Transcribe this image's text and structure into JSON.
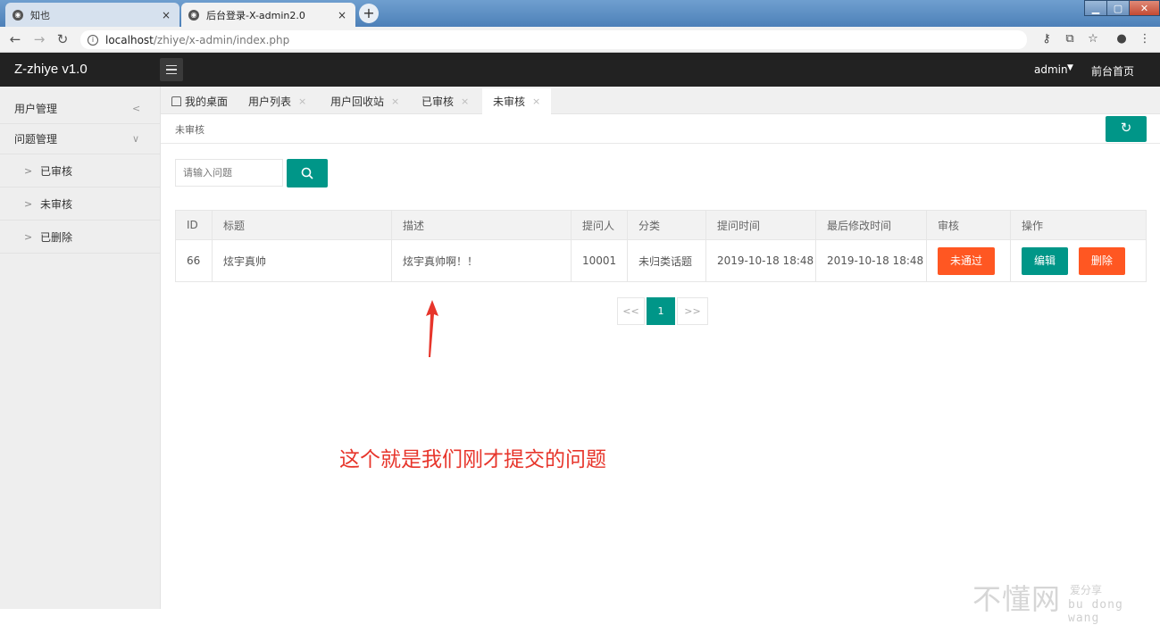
{
  "browser": {
    "tabs": [
      {
        "title": "知也",
        "active": false
      },
      {
        "title": "后台登录-X-admin2.0",
        "active": true
      }
    ],
    "new_tab": "+",
    "close_glyph": "×",
    "url_host": "localhost",
    "url_path": "/zhiye/x-admin/index.php",
    "nav_icons": [
      "back-icon",
      "forward-icon",
      "reload-icon",
      "info-icon"
    ],
    "toolbar_icons": [
      "key-icon",
      "translate-icon",
      "star-icon",
      "account-icon",
      "menu-icon"
    ]
  },
  "header": {
    "logo": "Z-zhiye v1.0",
    "user": "admin",
    "front_page": "前台首页"
  },
  "sidebar": {
    "items": [
      {
        "label": "用户管理",
        "arrow": "<"
      },
      {
        "label": "问题管理",
        "arrow": "∨"
      }
    ],
    "sub_items": [
      {
        "label": "已审核"
      },
      {
        "label": "未审核"
      },
      {
        "label": "已删除"
      }
    ],
    "chevron": ">"
  },
  "page_tabs": [
    {
      "label": "我的桌面",
      "closable": false
    },
    {
      "label": "用户列表",
      "closable": true
    },
    {
      "label": "用户回收站",
      "closable": true
    },
    {
      "label": "已审核",
      "closable": true
    },
    {
      "label": "未审核",
      "closable": true,
      "active": true
    }
  ],
  "breadcrumb": "未审核",
  "search": {
    "placeholder": "请输入问题"
  },
  "table": {
    "columns": [
      "ID",
      "标题",
      "描述",
      "提问人",
      "分类",
      "提问时间",
      "最后修改时间",
      "审核",
      "操作"
    ],
    "rows": [
      {
        "id": "66",
        "title": "炫宇真帅",
        "description": "炫宇真帅啊！！",
        "asker": "10001",
        "category": "未归类话题",
        "created": "2019-10-18 18:48",
        "modified": "2019-10-18 18:48",
        "review_btn": "未通过",
        "edit_btn": "编辑",
        "delete_btn": "删除"
      }
    ]
  },
  "pagination": {
    "prev": "<<",
    "current": "1",
    "next": ">>"
  },
  "annotation": "这个就是我们刚才提交的问题",
  "watermark": {
    "big": "不懂网",
    "small": "爱分享",
    "pinyin": "bu dong wang"
  },
  "colors": {
    "primary": "#009688",
    "danger": "#ff5722",
    "header": "#222222",
    "annotation": "#e7352b"
  }
}
